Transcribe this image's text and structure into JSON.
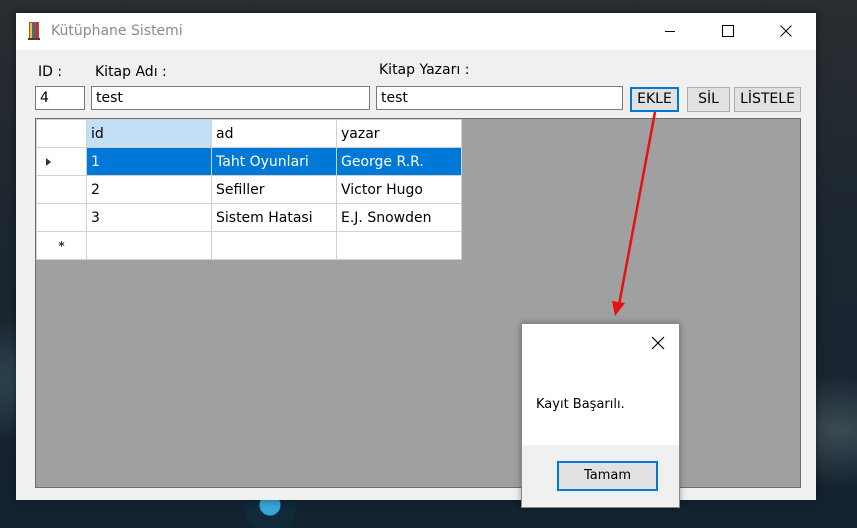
{
  "window": {
    "title": "Kütüphane Sistemi"
  },
  "form": {
    "id_label": "ID :",
    "book_name_label": "Kitap Adı :",
    "author_label": "Kitap Yazarı :",
    "id_value": "4",
    "book_name_value": "test",
    "author_value": "test"
  },
  "buttons": {
    "add": "EKLE",
    "delete": "SİL",
    "list": "LİSTELE"
  },
  "grid": {
    "columns": [
      "id",
      "ad",
      "yazar"
    ],
    "rows": [
      [
        "1",
        "Taht Oyunlari",
        "George R.R."
      ],
      [
        "2",
        "Sefiller",
        "Victor Hugo"
      ],
      [
        "3",
        "Sistem Hatasi",
        "E.J. Snowden"
      ]
    ],
    "new_row_marker": "*"
  },
  "dialog": {
    "message": "Kayıt Başarılı.",
    "ok_label": "Tamam"
  },
  "colors": {
    "selection": "#0078d7",
    "arrow": "#e81010"
  }
}
